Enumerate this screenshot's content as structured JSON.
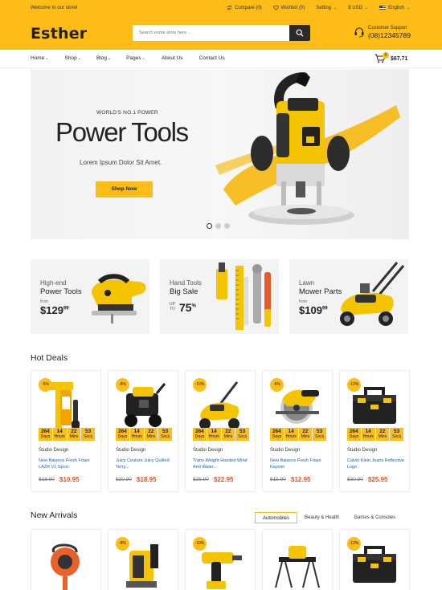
{
  "topbar": {
    "welcome": "Welcome to our store!",
    "compare": "Compare (0)",
    "wishlist": "Wishlist (0)",
    "setting": "Setting",
    "currency": "$ USD",
    "language": "English"
  },
  "header": {
    "logo": "Esther",
    "search_placeholder": "Search entire store here ...",
    "support_label": "Customer Support",
    "support_phone": "(08)12345789"
  },
  "nav": {
    "items": [
      "Home",
      "Shop",
      "Blog",
      "Pages",
      "About Us",
      "Contact Us"
    ],
    "cart_count": "0",
    "cart_total": "$67.71"
  },
  "hero": {
    "tagline": "WORLD'S NO.1 POWER",
    "title": "Power Tools",
    "subtitle": "Lorem Ipsum Dolor Sit Amet.",
    "button": "Shop Now",
    "active_slide": 1,
    "slides": 3
  },
  "promos": [
    {
      "line1": "High-end",
      "line2": "Power Tools",
      "from": "from",
      "price": "$129",
      "cents": "99"
    },
    {
      "line1": "Hand Tools",
      "line2": "Big Sale",
      "upto1": "UP",
      "upto2": "TO",
      "percent": "75",
      "pct_sign": "%"
    },
    {
      "line1": "Lawn",
      "line2": "Mower Parts",
      "from": "from",
      "price": "$109",
      "cents": "99"
    }
  ],
  "hot_deals": {
    "title": "Hot Deals",
    "timer_labels": [
      "Days",
      "Hours",
      "Mins",
      "Secs"
    ],
    "products": [
      {
        "badge": "-5%",
        "timer": [
          "264",
          "14",
          "22",
          "53"
        ],
        "category": "Studio Design",
        "name": "New Balance Fresh Foam LAZR V1 Sport",
        "old": "$18.90",
        "new": "$10.95",
        "icon": "clamp-icon"
      },
      {
        "badge": "-8%",
        "timer": [
          "264",
          "14",
          "22",
          "53"
        ],
        "category": "Studio Design",
        "name": "Juicy Couture Juicy Quilted Terry...",
        "old": "$20.90",
        "new": "$18.95",
        "icon": "pressure-washer-icon"
      },
      {
        "badge": "-10%",
        "timer": [
          "264",
          "14",
          "22",
          "53"
        ],
        "category": "Studio Design",
        "name": "Trans-Weight Hooded Wind And Water...",
        "old": "$25.90",
        "new": "$22.95",
        "icon": "lawn-mower-icon"
      },
      {
        "badge": "-6%",
        "timer": [
          "264",
          "14",
          "22",
          "53"
        ],
        "category": "Studio Design",
        "name": "New Balance Fresh Foam Kaymin",
        "old": "$15.90",
        "new": "$12.95",
        "icon": "circular-saw-icon"
      },
      {
        "badge": "-12%",
        "timer": [
          "264",
          "14",
          "22",
          "53"
        ],
        "category": "Studio Design",
        "name": "Calvin Klein Jeans Reflective Logo",
        "old": "$30.90",
        "new": "$25.95",
        "icon": "toolbox-icon"
      }
    ]
  },
  "new_arrivals": {
    "title": "New Arrivals",
    "tabs": [
      "Automobiles",
      "Beauty & Health",
      "Games & Consoles"
    ],
    "products": [
      {
        "badge": "",
        "icon": "tape-measure-icon"
      },
      {
        "badge": "-8%",
        "icon": "dust-extractor-icon"
      },
      {
        "badge": "-10%",
        "icon": "drill-icon"
      },
      {
        "badge": "",
        "icon": "saw-stand-icon"
      },
      {
        "badge": "-12%",
        "icon": "toolbox-icon"
      }
    ]
  },
  "colors": {
    "accent": "#fdbc16",
    "dark": "#2b2b2b",
    "price": "#e8502a",
    "link": "#1f5fa8"
  }
}
